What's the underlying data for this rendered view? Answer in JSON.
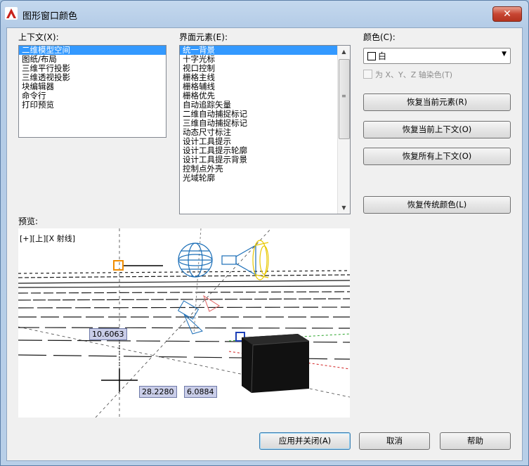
{
  "window": {
    "title": "图形窗口颜色",
    "close_label": "✕"
  },
  "context": {
    "label": "上下文(X):",
    "items": [
      "二维模型空间",
      "图纸/布局",
      "三维平行投影",
      "三维透视投影",
      "块编辑器",
      "命令行",
      "打印预览"
    ],
    "selected_index": 0
  },
  "interface": {
    "label": "界面元素(E):",
    "items": [
      "统一背景",
      "十字光标",
      "视口控制",
      "栅格主线",
      "栅格辅线",
      "栅格优先",
      "自动追踪矢量",
      "二维自动捕捉标记",
      "三维自动捕捉标记",
      "动态尺寸标注",
      "设计工具提示",
      "设计工具提示轮廓",
      "设计工具提示背景",
      "控制点外壳",
      "光域轮廓"
    ],
    "selected_index": 0
  },
  "color": {
    "label": "颜色(C):",
    "value": "白",
    "tint_checkbox_label": "为 X、Y、Z 轴染色(T)",
    "tint_checked": false
  },
  "buttons": {
    "restore_element": "恢复当前元素(R)",
    "restore_context": "恢复当前上下文(O)",
    "restore_all": "恢复所有上下文(O)",
    "restore_classic": "恢复传统颜色(L)",
    "apply_close": "应用并关闭(A)",
    "cancel": "取消",
    "help": "帮助"
  },
  "preview": {
    "label": "预览:",
    "viewport_label": "[+][上][X 射线]",
    "dim_vertical": "10.6063",
    "dim_x": "28.2280",
    "dim_y": "6.0884"
  },
  "colors": {
    "selection": "#3399ff",
    "cursor_box": "#f08c00",
    "light_glyph": "#1c6fb8",
    "spot_glyph": "#e8c800"
  }
}
